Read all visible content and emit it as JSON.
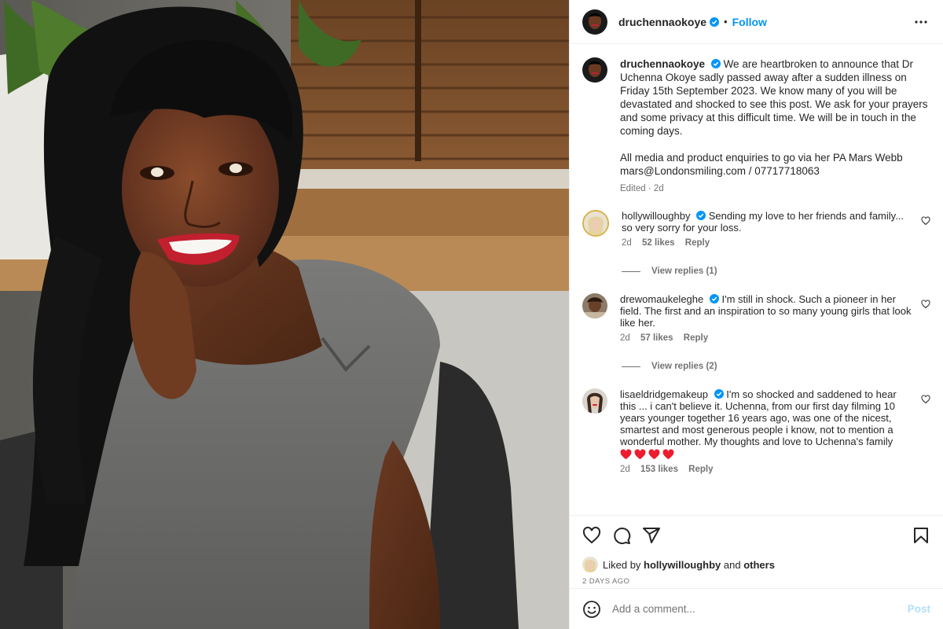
{
  "post": {
    "author": "druchennaokoye",
    "follow_label": "Follow",
    "separator": "•",
    "caption_p1": "We are heartbroken to announce that Dr Uchenna Okoye sadly passed away after a sudden illness on Friday 15th September 2023. We know many of you will be devastated and shocked to see this post. We ask for your prayers and some privacy at this difficult time. We will be in touch in the coming days.",
    "caption_p2": "All media and product enquiries to go via her PA Mars Webb mars@Londonsmiling.com / 07717718063",
    "caption_meta": "Edited · 2d"
  },
  "comments": [
    {
      "user": "hollywilloughby",
      "text": "Sending my love to her friends and family... so very sorry for your loss.",
      "time": "2d",
      "likes": "52 likes",
      "reply": "Reply",
      "view_replies": "View replies (1)"
    },
    {
      "user": "drewomaukeleghe",
      "text": "I'm still in shock. Such a pioneer in her field. The first and an inspiration to so many young girls that look like her.",
      "time": "2d",
      "likes": "57 likes",
      "reply": "Reply",
      "view_replies": "View replies (2)"
    },
    {
      "user": "lisaeldridgemakeup",
      "text": "I'm so shocked and saddened to hear this ... i can't believe it. Uchenna, from our first day filming 10 years younger together 16 years ago, was one of the nicest, smartest and most generous people i know, not to mention a wonderful mother. My thoughts and love to Uchenna's family",
      "time": "2d",
      "likes": "153 likes",
      "reply": "Reply"
    }
  ],
  "footer": {
    "liked_prefix": "Liked by",
    "liked_user": "hollywilloughby",
    "liked_and": "and",
    "liked_others": "others",
    "time_ago": "2 DAYS AGO",
    "add_comment_placeholder": "Add a comment...",
    "post_label": "Post"
  },
  "icons": {
    "heart": "heart-icon",
    "comment": "comment-icon",
    "share": "share-icon",
    "save": "bookmark-icon",
    "emoji": "emoji-icon",
    "more": "more-icon",
    "verified": "verified-badge-icon"
  },
  "colors": {
    "accent": "#0095f6",
    "verified": "#0095f6",
    "heart_red": "#ed4956",
    "text": "#262626",
    "muted": "#737373"
  }
}
